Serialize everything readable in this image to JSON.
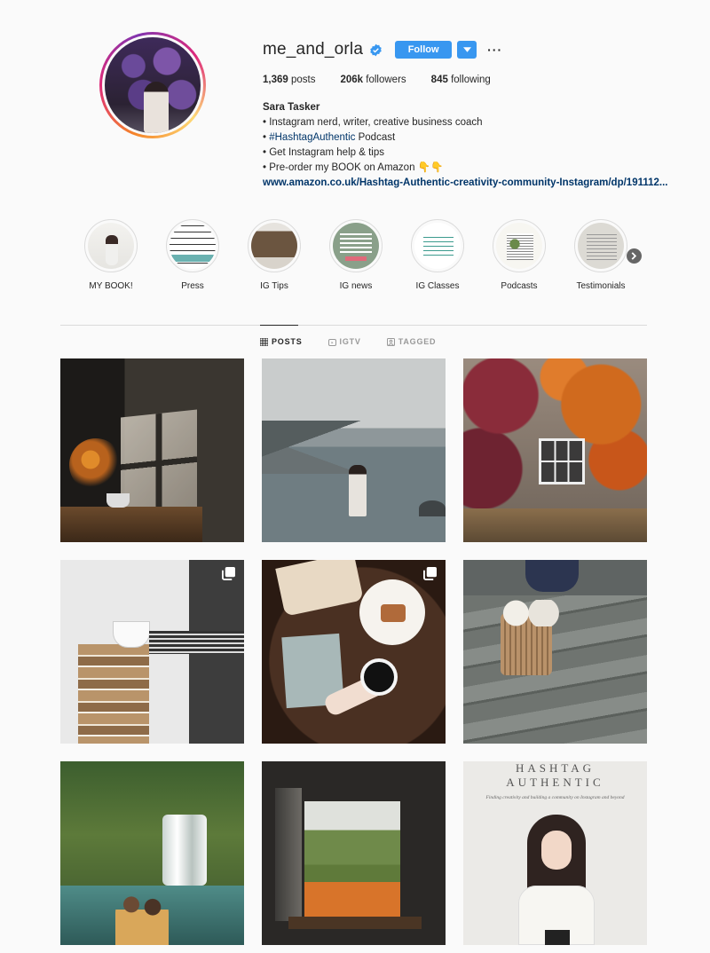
{
  "profile": {
    "username": "me_and_orla",
    "follow_label": "Follow",
    "more_label": "···",
    "stats": {
      "posts_count": "1,369",
      "posts_label": "posts",
      "followers_count": "206k",
      "followers_label": "followers",
      "following_count": "845",
      "following_label": "following"
    },
    "bio": {
      "name": "Sara Tasker",
      "line1": "• Instagram nerd, writer, creative business coach",
      "line2_prefix": "• ",
      "line2_tag": "#HashtagAuthentic",
      "line2_suffix": " Podcast",
      "line3": "• Get Instagram help & tips",
      "line4": "• Pre-order my BOOK on Amazon 👇👇",
      "link": "www.amazon.co.uk/Hashtag-Authentic-creativity-community-Instagram/dp/191112..."
    }
  },
  "highlights": [
    {
      "label": "MY BOOK!"
    },
    {
      "label": "Press"
    },
    {
      "label": "IG Tips"
    },
    {
      "label": "IG news"
    },
    {
      "label": "IG Classes"
    },
    {
      "label": "Podcasts"
    },
    {
      "label": "Testimonials"
    }
  ],
  "tabs": [
    {
      "label": "POSTS",
      "icon": "grid-icon",
      "active": true
    },
    {
      "label": "IGTV",
      "icon": "igtv-icon",
      "active": false
    },
    {
      "label": "TAGGED",
      "icon": "tagged-icon",
      "active": false
    }
  ],
  "posts": [
    {
      "id": 1,
      "multi": false
    },
    {
      "id": 2,
      "multi": false
    },
    {
      "id": 3,
      "multi": false
    },
    {
      "id": 4,
      "multi": true
    },
    {
      "id": 5,
      "multi": true
    },
    {
      "id": 6,
      "multi": false
    },
    {
      "id": 7,
      "multi": false
    },
    {
      "id": 8,
      "multi": false
    },
    {
      "id": 9,
      "multi": false,
      "cover_title_1": "HASHTAG",
      "cover_title_2": "AUTHENTIC",
      "cover_subtitle": "Finding creativity and building a community on Instagram and beyond"
    }
  ],
  "colors": {
    "accent": "#3897f0",
    "link": "#003569",
    "text": "#262626",
    "muted": "#999999",
    "background": "#fafafa"
  }
}
